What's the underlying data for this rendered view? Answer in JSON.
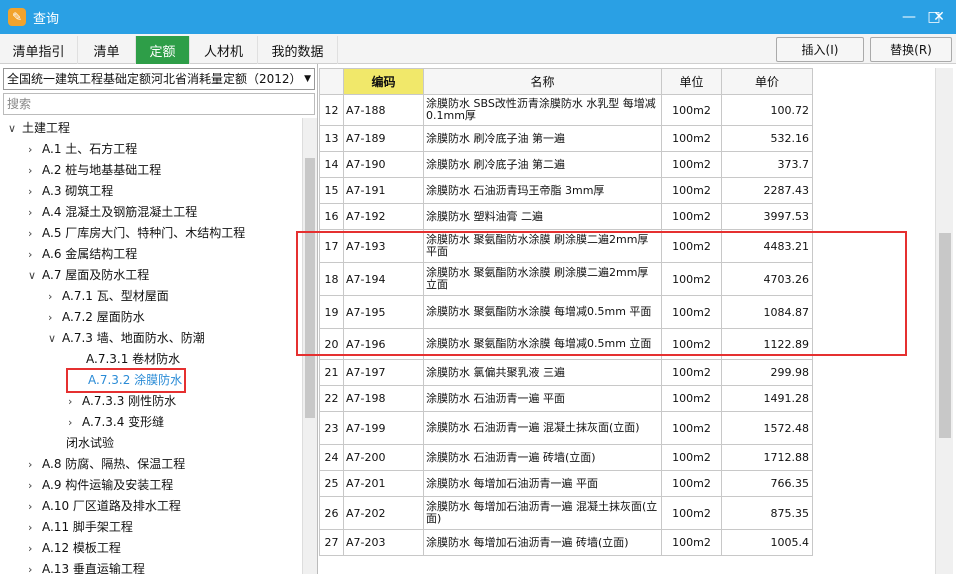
{
  "window": {
    "title": "查询",
    "minimize": "—",
    "maximize": "□",
    "close": "✕"
  },
  "tabs": [
    {
      "label": "清单指引",
      "active": false
    },
    {
      "label": "清单",
      "active": false
    },
    {
      "label": "定额",
      "active": true
    },
    {
      "label": "人材机",
      "active": false
    },
    {
      "label": "我的数据",
      "active": false
    }
  ],
  "toolbar": {
    "insert_label": "插入(I)",
    "replace_label": "替换(R)"
  },
  "left": {
    "library": "全国统一建筑工程基础定额河北省消耗量定额（2012）",
    "search_placeholder": "搜索",
    "tree": [
      {
        "label": "土建工程",
        "toggle": "∨",
        "level": 0
      },
      {
        "label": "A.1 土、石方工程",
        "toggle": "›",
        "level": 1
      },
      {
        "label": "A.2 桩与地基基础工程",
        "toggle": "›",
        "level": 1
      },
      {
        "label": "A.3 砌筑工程",
        "toggle": "›",
        "level": 1
      },
      {
        "label": "A.4 混凝土及钢筋混凝土工程",
        "toggle": "›",
        "level": 1
      },
      {
        "label": "A.5 厂库房大门、特种门、木结构工程",
        "toggle": "›",
        "level": 1
      },
      {
        "label": "A.6 金属结构工程",
        "toggle": "›",
        "level": 1
      },
      {
        "label": "A.7 屋面及防水工程",
        "toggle": "∨",
        "level": 1
      },
      {
        "label": "A.7.1 瓦、型材屋面",
        "toggle": "›",
        "level": 2
      },
      {
        "label": "A.7.2 屋面防水",
        "toggle": "›",
        "level": 2
      },
      {
        "label": "A.7.3 墙、地面防水、防潮",
        "toggle": "∨",
        "level": 2
      },
      {
        "label": "A.7.3.1 卷材防水",
        "toggle": "",
        "level": 3
      },
      {
        "label": "A.7.3.2 涂膜防水",
        "toggle": "",
        "level": 3,
        "selected": true
      },
      {
        "label": "A.7.3.3 刚性防水",
        "toggle": "›",
        "level": 3
      },
      {
        "label": "A.7.3.4 变形缝",
        "toggle": "›",
        "level": 3
      },
      {
        "label": "闭水试验",
        "toggle": "",
        "level": 2.5
      },
      {
        "label": "A.8 防腐、隔热、保温工程",
        "toggle": "›",
        "level": 1
      },
      {
        "label": "A.9 构件运输及安装工程",
        "toggle": "›",
        "level": 1
      },
      {
        "label": "A.10 厂区道路及排水工程",
        "toggle": "›",
        "level": 1
      },
      {
        "label": "A.11 脚手架工程",
        "toggle": "›",
        "level": 1
      },
      {
        "label": "A.12 模板工程",
        "toggle": "›",
        "level": 1
      },
      {
        "label": "A.13 垂直运输工程",
        "toggle": "›",
        "level": 1
      }
    ]
  },
  "grid": {
    "headers": [
      "",
      "编码",
      "名称",
      "单位",
      "单价"
    ],
    "rows": [
      {
        "no": "12",
        "code": "A7-188",
        "name": "涂膜防水 SBS改性沥青涂膜防水 水乳型 每增减0.1mm厚",
        "unit": "100m2",
        "price": "100.72"
      },
      {
        "no": "13",
        "code": "A7-189",
        "name": "涂膜防水 刷冷底子油 第一遍",
        "unit": "100m2",
        "price": "532.16"
      },
      {
        "no": "14",
        "code": "A7-190",
        "name": "涂膜防水 刷冷底子油 第二遍",
        "unit": "100m2",
        "price": "373.7"
      },
      {
        "no": "15",
        "code": "A7-191",
        "name": "涂膜防水 石油沥青玛王帝脂 3mm厚",
        "unit": "100m2",
        "price": "2287.43"
      },
      {
        "no": "16",
        "code": "A7-192",
        "name": "涂膜防水 塑料油膏 二遍",
        "unit": "100m2",
        "price": "3997.53"
      },
      {
        "no": "17",
        "code": "A7-193",
        "name": "涂膜防水 聚氨酯防水涂膜 刷涂膜二遍2mm厚 平面",
        "unit": "100m2",
        "price": "4483.21"
      },
      {
        "no": "18",
        "code": "A7-194",
        "name": "涂膜防水 聚氨酯防水涂膜 刷涂膜二遍2mm厚 立面",
        "unit": "100m2",
        "price": "4703.26"
      },
      {
        "no": "19",
        "code": "A7-195",
        "name": "涂膜防水 聚氨酯防水涂膜 每增减0.5mm 平面",
        "unit": "100m2",
        "price": "1084.87"
      },
      {
        "no": "20",
        "code": "A7-196",
        "name": "涂膜防水 聚氨酯防水涂膜 每增减0.5mm 立面",
        "unit": "100m2",
        "price": "1122.89"
      },
      {
        "no": "21",
        "code": "A7-197",
        "name": "涂膜防水 氯偏共聚乳液 三遍",
        "unit": "100m2",
        "price": "299.98"
      },
      {
        "no": "22",
        "code": "A7-198",
        "name": "涂膜防水 石油沥青一遍 平面",
        "unit": "100m2",
        "price": "1491.28"
      },
      {
        "no": "23",
        "code": "A7-199",
        "name": "涂膜防水 石油沥青一遍 混凝土抹灰面(立面)",
        "unit": "100m2",
        "price": "1572.48"
      },
      {
        "no": "24",
        "code": "A7-200",
        "name": "涂膜防水 石油沥青一遍 砖墙(立面)",
        "unit": "100m2",
        "price": "1712.88"
      },
      {
        "no": "25",
        "code": "A7-201",
        "name": "涂膜防水 每增加石油沥青一遍 平面",
        "unit": "100m2",
        "price": "766.35"
      },
      {
        "no": "26",
        "code": "A7-202",
        "name": "涂膜防水 每增加石油沥青一遍 混凝土抹灰面(立面)",
        "unit": "100m2",
        "price": "875.35"
      },
      {
        "no": "27",
        "code": "A7-203",
        "name": "涂膜防水 每增加石油沥青一遍 砖墙(立面)",
        "unit": "100m2",
        "price": "1005.4"
      }
    ]
  }
}
